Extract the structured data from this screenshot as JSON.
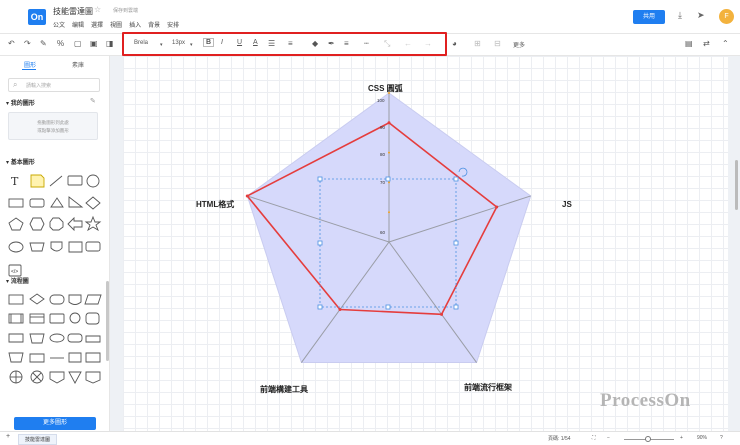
{
  "header": {
    "logo_text": "On",
    "doc_title": "技能雷達圖",
    "save_status": "保存到雲端",
    "menu": [
      "公文",
      "编辑",
      "選擇",
      "視圖",
      "插入",
      "背景",
      "安排"
    ],
    "share_label": "共用",
    "avatar_letter": "F"
  },
  "toolbar": {
    "font_family": "Brela",
    "font_size": "13px",
    "bold": "B",
    "italic": "I",
    "underline": "U",
    "font_color": "A",
    "more_label": "更多"
  },
  "sidebar": {
    "tab_shapes": "圖形",
    "tab_library": "素庫",
    "search_placeholder": "請輸入搜索",
    "my_shapes_title": "我的圖形",
    "my_shapes_hint1": "拖動圖形到此處",
    "my_shapes_hint2": "或點擊添加圖形",
    "basic_shapes_title": "基本圖形",
    "flowchart_title": "流程圖",
    "more_shapes_button": "更多圖形"
  },
  "chart_data": {
    "type": "radar",
    "axes": [
      "CSS 圓弧",
      "JS",
      "前端流行框架",
      "前端構建工具",
      "HTML格式"
    ],
    "ticks": [
      60,
      70,
      80,
      90,
      100
    ],
    "rmin": 50,
    "rmax": 100,
    "series": [
      {
        "values": [
          90,
          88,
          80,
          78,
          100
        ]
      }
    ],
    "colors": {
      "fill": "#d6d9fb",
      "line": "#e53d3d",
      "axis": "#9a9da6"
    },
    "watermark": "ProcessOn"
  },
  "footer": {
    "page_name": "技能雷達圖",
    "add_page": "+",
    "page_info": "頁碼: 1/54",
    "zoom": "90%"
  }
}
